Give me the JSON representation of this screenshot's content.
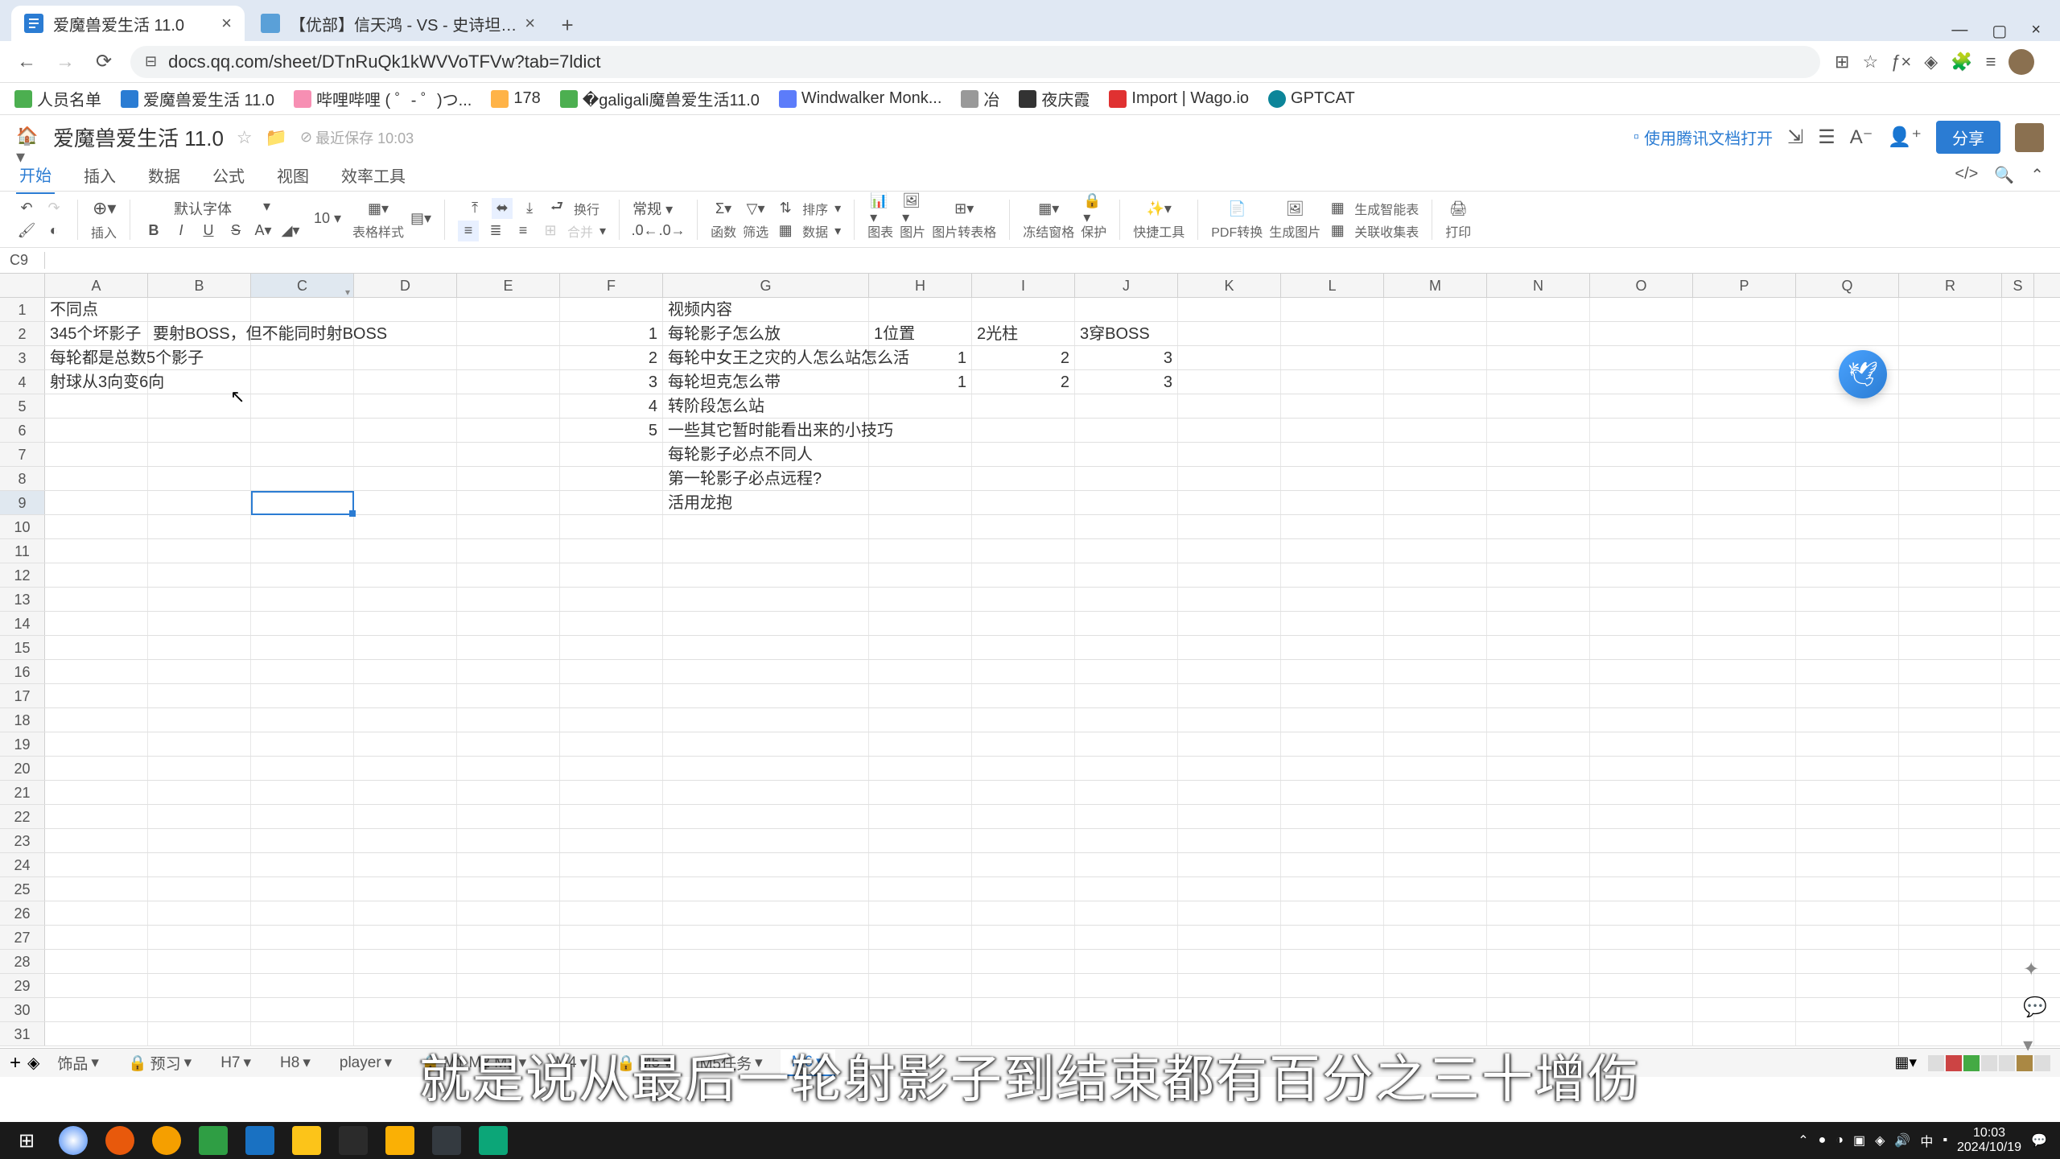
{
  "browser": {
    "tabs": [
      {
        "title": "爱魔兽爱生活 11.0"
      },
      {
        "title": "【优部】信天鸿 - VS - 史诗坦…"
      }
    ],
    "url": "docs.qq.com/sheet/DTnRuQk1kWVVoTFVw?tab=7ldict"
  },
  "bookmarks": [
    "人员名单",
    "爱魔兽爱生活 11.0",
    "哔哩哔哩 ( ゜- ゜)つ...",
    "178",
    "�galigali魔兽爱生活11.0",
    "Windwalker Monk...",
    "冶",
    "夜庆霞",
    "Import | Wago.io",
    "GPTCAT"
  ],
  "app": {
    "title": "爱魔兽爱生活 11.0",
    "save_info": "最近保存 10:03",
    "tencent_open": "使用腾讯文档打开",
    "share": "分享"
  },
  "menu": [
    "开始",
    "插入",
    "数据",
    "公式",
    "视图",
    "效率工具"
  ],
  "toolbar": {
    "font_family": "默认字体",
    "font_size": "10",
    "format_general": "常规",
    "insert_label": "插入",
    "style_label": "表格样式",
    "wrap_label": "换行",
    "merge_label": "合并",
    "func_label": "函数",
    "filter_label": "筛选",
    "data_label": "数据",
    "sort_label": "排序",
    "chart_label": "图表",
    "image_label": "图片",
    "img2table_label": "图片转表格",
    "freeze_label": "冻结窗格",
    "protect_label": "保护",
    "tool_label": "快捷工具",
    "pdf_label": "PDF转换",
    "genimg_label": "生成图片",
    "smart_label": "生成智能表",
    "collect_label": "关联收集表",
    "print_label": "打印"
  },
  "cell_ref": "C9",
  "columns": [
    "A",
    "B",
    "C",
    "D",
    "E",
    "F",
    "G",
    "H",
    "I",
    "J",
    "K",
    "L",
    "M",
    "N",
    "O",
    "P",
    "Q",
    "R",
    "S"
  ],
  "rows": {
    "1": {
      "A": "不同点",
      "G": "视频内容"
    },
    "2": {
      "A": "345个坏影子",
      "B": "要射BOSS，但不能同时射BOSS",
      "F": "1",
      "G": "每轮影子怎么放",
      "H": "1位置",
      "I": "2光柱",
      "J": "3穿BOSS"
    },
    "3": {
      "A": "每轮都是总数5个影子",
      "F": "2",
      "G": "每轮中女王之灾的人怎么站怎么活",
      "H": "1",
      "I": "2",
      "J": "3"
    },
    "4": {
      "A": "射球从3向变6向",
      "F": "3",
      "G": "每轮坦克怎么带",
      "H": "1",
      "I": "2",
      "J": "3"
    },
    "5": {
      "F": "4",
      "G": "转阶段怎么站"
    },
    "6": {
      "F": "5",
      "G": "一些其它暂时能看出来的小技巧"
    },
    "7": {
      "G": "每轮影子必点不同人"
    },
    "8": {
      "G": "第一轮影子必点远程?"
    },
    "9": {
      "G": "活用龙抱"
    }
  },
  "sheet_tabs": [
    "饰品",
    "预习",
    "H7",
    "H8",
    "player",
    "M1 M2 M3",
    "M4",
    "M5",
    "M5任务",
    "M6"
  ],
  "taskbar": {
    "time": "10:03",
    "date": "2024/10/19"
  },
  "subtitle": "就是说从最后一轮射影子到结束都有百分之三十增伤"
}
